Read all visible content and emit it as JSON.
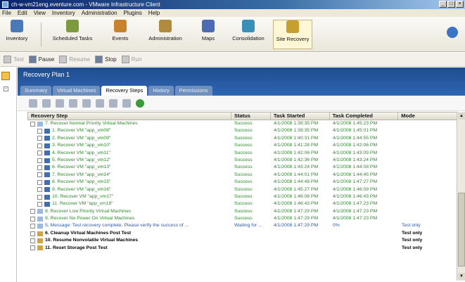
{
  "window": {
    "title": "ch-w-vm21eng.eventure.com - VMware Infrastructure Client",
    "controls": [
      "_",
      "□",
      "×"
    ]
  },
  "menubar": [
    "File",
    "Edit",
    "View",
    "Inventory",
    "Administration",
    "Plugins",
    "Help"
  ],
  "toolbar": {
    "buttons": [
      {
        "label": "Inventory",
        "icon": "inventory-icon",
        "color": "#4a79b8"
      },
      {
        "label": "Scheduled Tasks",
        "icon": "calendar-icon",
        "color": "#7c9a3e"
      },
      {
        "label": "Events",
        "icon": "events-icon",
        "color": "#c9822c"
      },
      {
        "label": "Administration",
        "icon": "admin-icon",
        "color": "#b08a3d"
      },
      {
        "label": "Maps",
        "icon": "maps-icon",
        "color": "#4b6bb5"
      },
      {
        "label": "Consolidation",
        "icon": "consolidation-icon",
        "color": "#3a8fb6"
      },
      {
        "label": "Site Recovery",
        "icon": "site-recovery-icon",
        "color": "#c6a02f"
      }
    ],
    "help_icon": "help-icon"
  },
  "subtoolbar": [
    {
      "label": "Test",
      "enabled": false
    },
    {
      "label": "Pause",
      "enabled": true
    },
    {
      "label": "Resume",
      "enabled": false
    },
    {
      "label": "Stop",
      "enabled": true
    },
    {
      "label": "Run",
      "enabled": false
    }
  ],
  "panel": {
    "title": "Recovery Plan 1",
    "tabs": [
      "Summary",
      "Virtual Machines",
      "Recovery Steps",
      "History",
      "Permissions"
    ],
    "active_tab": "Recovery Steps",
    "step_tool_icons": [
      "expand-icon",
      "collapse-icon",
      "add-icon",
      "edit-icon",
      "delete-icon",
      "up-icon",
      "down-icon",
      "props-icon",
      "run-icon"
    ]
  },
  "grid": {
    "headers": [
      "Recovery Step",
      "Status",
      "Task Started",
      "Task Completed",
      "Mode"
    ],
    "rows": [
      {
        "indent": 0,
        "kind": "ok",
        "step": "7. Recover Normal Priority Virtual Machines",
        "status": "Success",
        "started": "4/1/2008 1:39:35 PM",
        "completed": "4/1/2008 1:45:23 PM",
        "mode": ""
      },
      {
        "indent": 1,
        "kind": "ok",
        "step": "1. Recover VM \"app_vm08\"",
        "status": "Success",
        "started": "4/1/2008 1:39:35 PM",
        "completed": "4/1/2008 1:45:01 PM",
        "mode": ""
      },
      {
        "indent": 1,
        "kind": "ok",
        "step": "2. Recover VM \"app_vm09\"",
        "status": "Success",
        "started": "4/1/2008 1:40:31 PM",
        "completed": "4/1/2008 1:44:55 PM",
        "mode": ""
      },
      {
        "indent": 1,
        "kind": "ok",
        "step": "3. Recover VM \"app_vm10\"",
        "status": "Success",
        "started": "4/1/2008 1:41:28 PM",
        "completed": "4/1/2008 1:42:06 PM",
        "mode": ""
      },
      {
        "indent": 1,
        "kind": "ok",
        "step": "4. Recover VM \"app_vm11\"",
        "status": "Success",
        "started": "4/1/2008 1:42:06 PM",
        "completed": "4/1/2008 1:43:09 PM",
        "mode": ""
      },
      {
        "indent": 1,
        "kind": "ok",
        "step": "5. Recover VM \"app_vm12\"",
        "status": "Success",
        "started": "4/1/2008 1:42:36 PM",
        "completed": "4/1/2008 1:43:24 PM",
        "mode": ""
      },
      {
        "indent": 1,
        "kind": "ok",
        "step": "6. Recover VM \"app_vm13\"",
        "status": "Success",
        "started": "4/1/2008 1:43:24 PM",
        "completed": "4/1/2008 1:44:08 PM",
        "mode": ""
      },
      {
        "indent": 1,
        "kind": "ok",
        "step": "7. Recover VM \"app_vm14\"",
        "status": "Success",
        "started": "4/1/2008 1:44:01 PM",
        "completed": "4/1/2008 1:44:45 PM",
        "mode": ""
      },
      {
        "indent": 1,
        "kind": "ok",
        "step": "8. Recover VM \"app_vm15\"",
        "status": "Success",
        "started": "4/1/2008 1:44:48 PM",
        "completed": "4/1/2008 1:47:27 PM",
        "mode": ""
      },
      {
        "indent": 1,
        "kind": "ok",
        "step": "9. Recover VM \"app_vm16\"",
        "status": "Success",
        "started": "4/1/2008 1:45:27 PM",
        "completed": "4/1/2008 1:46:09 PM",
        "mode": ""
      },
      {
        "indent": 1,
        "kind": "ok",
        "step": "10. Recover VM \"app_vm17\"",
        "status": "Success",
        "started": "4/1/2008 1:46:06 PM",
        "completed": "4/1/2008 1:46:43 PM",
        "mode": ""
      },
      {
        "indent": 1,
        "kind": "ok",
        "step": "11. Recover VM \"app_vm18\"",
        "status": "Success",
        "started": "4/1/2008 1:46:43 PM",
        "completed": "4/1/2008 1:47:23 PM",
        "mode": ""
      },
      {
        "indent": 0,
        "kind": "ok",
        "step": "8. Recover Low Priority Virtual Machines",
        "status": "Success",
        "started": "4/1/2008 1:47:29 PM",
        "completed": "4/1/2008 1:47:23 PM",
        "mode": ""
      },
      {
        "indent": 0,
        "kind": "ok",
        "step": "9. Recover No Power On Virtual Machines",
        "status": "Success",
        "started": "4/1/2008 1:47:29 PM",
        "completed": "4/1/2008 1:47:23 PM",
        "mode": ""
      },
      {
        "indent": 0,
        "kind": "run",
        "step": "5. Message: Test recovery complete. Please verify the success of ...",
        "status": "Waiting for ...",
        "started": "4/1/2008 1:47:29 PM",
        "completed": "0%",
        "mode": "Test only"
      },
      {
        "indent": 0,
        "kind": "bold",
        "step": "6. Cleanup Virtual Machines Post Test",
        "status": "",
        "started": "",
        "completed": "",
        "mode": "Test only"
      },
      {
        "indent": 0,
        "kind": "bold",
        "step": "10. Resume Nonvolatile Virtual Machines",
        "status": "",
        "started": "",
        "completed": "",
        "mode": "Test only"
      },
      {
        "indent": 0,
        "kind": "bold",
        "step": "11. Reset Storage Post Test",
        "status": "",
        "started": "",
        "completed": "",
        "mode": "Test only"
      }
    ]
  },
  "colors": {
    "success_text": "#2f8a2f",
    "running_text": "#2e5aa8",
    "header_blue": "#1f4c8f"
  }
}
